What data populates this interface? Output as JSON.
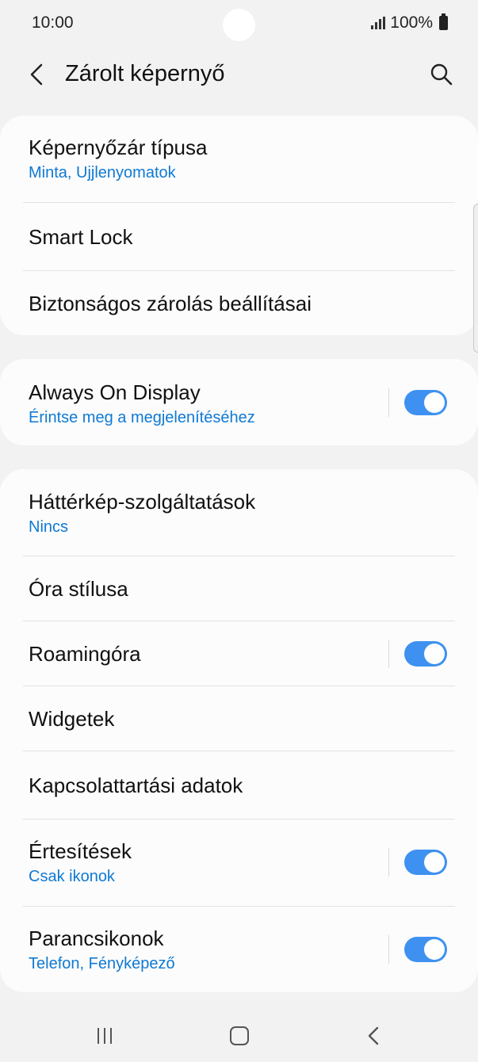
{
  "status": {
    "time": "10:00",
    "battery": "100%"
  },
  "header": {
    "title": "Zárolt képernyő"
  },
  "groups": [
    {
      "items": [
        {
          "label": "Képernyőzár típusa",
          "sub": "Minta, Ujjlenyomatok"
        },
        {
          "label": "Smart Lock"
        },
        {
          "label": "Biztonságos zárolás beállításai"
        }
      ]
    },
    {
      "items": [
        {
          "label": "Always On Display",
          "sub": "Érintse meg a megjelenítéséhez",
          "toggle": true
        }
      ]
    },
    {
      "items": [
        {
          "label": "Háttérkép-szolgáltatások",
          "sub": "Nincs"
        },
        {
          "label": "Óra stílusa"
        },
        {
          "label": "Roamingóra",
          "toggle": true
        },
        {
          "label": "Widgetek"
        },
        {
          "label": "Kapcsolattartási adatok"
        },
        {
          "label": "Értesítések",
          "sub": "Csak ikonok",
          "toggle": true
        },
        {
          "label": "Parancsikonok",
          "sub": "Telefon, Fényképező",
          "toggle": true
        }
      ]
    }
  ],
  "icons": {
    "back": "chevron-left-icon",
    "search": "search-icon",
    "nav_recent": "recent-apps-icon",
    "nav_home": "home-icon",
    "nav_back": "back-icon"
  },
  "colors": {
    "accent": "#3e91f0",
    "subtext": "#0f79d4",
    "background": "#f2f2f2",
    "card": "#fcfcfc"
  }
}
